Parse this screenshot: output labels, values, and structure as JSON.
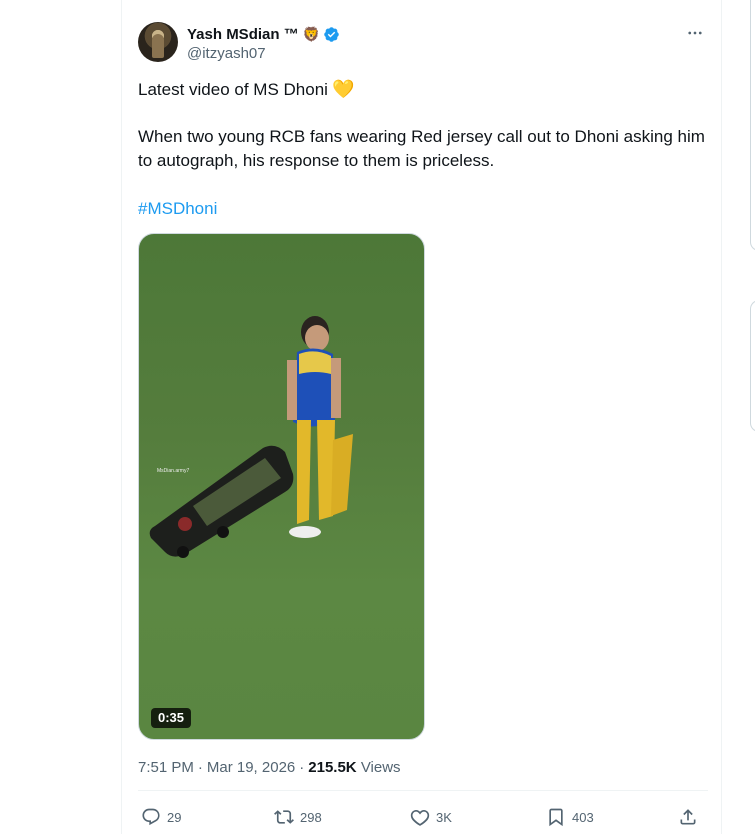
{
  "author": {
    "name": "Yash MSdian ™",
    "badge_emoji": "🦁",
    "handle": "@itzyash07"
  },
  "tweet": {
    "line1": "Latest video of MS Dhoni",
    "line1_emoji": "💛",
    "line2": "When two young RCB fans wearing Red jersey call out to Dhoni asking him to autograph, his response to them is priceless.",
    "hashtag": "#MSDhoni"
  },
  "video": {
    "duration": "0:35",
    "watermark": "MsDian.army7"
  },
  "meta": {
    "time": "7:51 PM",
    "separator": "·",
    "date": "Mar 19, 2026",
    "views_count": "215.5K",
    "views_label": "Views"
  },
  "actions": {
    "replies": "29",
    "reposts": "298",
    "likes": "3K",
    "bookmarks": "403"
  },
  "colors": {
    "accent": "#1d9bf0",
    "text_primary": "#0f1419",
    "text_secondary": "#536471",
    "verified": "#1d9bf0"
  },
  "icons": [
    "verified-badge-icon",
    "more-options-icon",
    "reply-icon",
    "repost-icon",
    "like-icon",
    "bookmark-icon",
    "share-icon"
  ]
}
